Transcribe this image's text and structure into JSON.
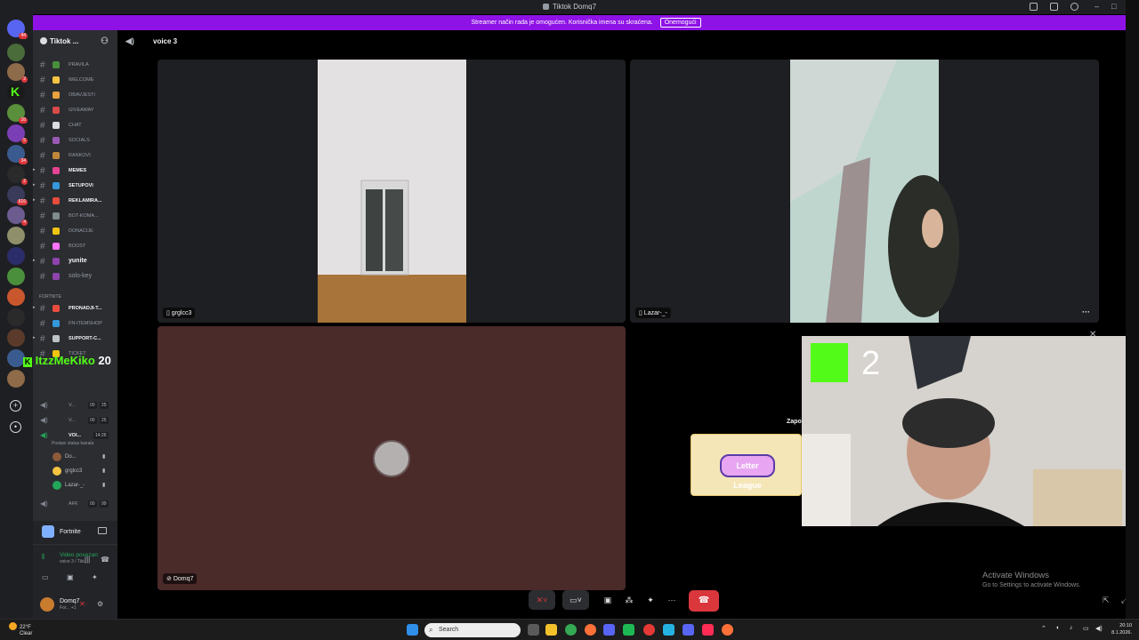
{
  "window": {
    "title": "Tiktok Domq7"
  },
  "banner": {
    "text": "Streamer način rada je omogućen. Korisnička imena su skraćena.",
    "button": "Onemogući"
  },
  "rail": {
    "home_badge": "44",
    "server_badges": [
      "2",
      "16",
      "5",
      "34",
      "2",
      "616",
      "4"
    ]
  },
  "server": {
    "name": "Tiktok ..."
  },
  "channels": [
    {
      "name": "PRAVILA",
      "emoji_color": "#4a8f3c"
    },
    {
      "name": "WELCOME",
      "emoji_color": "#f5c542"
    },
    {
      "name": "OBAVJESTI",
      "emoji_color": "#e8a23d"
    },
    {
      "name": "GIVEAWAY",
      "emoji_color": "#d94a4a"
    },
    {
      "name": "CHAT",
      "emoji_color": "#dbdee1"
    },
    {
      "name": "SOCIALS",
      "emoji_color": "#9b59b6"
    },
    {
      "name": "RANKOVI",
      "emoji_color": "#c0873a"
    },
    {
      "name": "MEMES",
      "emoji_color": "#e84393",
      "bold": true
    },
    {
      "name": "SETUPOVI",
      "emoji_color": "#3498db",
      "bold": true
    },
    {
      "name": "REKLAMIRA...",
      "emoji_color": "#e74c3c",
      "bold": true
    },
    {
      "name": "BOT-KOMA...",
      "emoji_color": "#7f8c8d"
    },
    {
      "name": "DONACIJE",
      "emoji_color": "#f1c40f"
    },
    {
      "name": "BOOST",
      "emoji_color": "#ff73fa"
    },
    {
      "name": "yunite",
      "emoji_color": "#8e44ad",
      "bold": true,
      "big": true
    },
    {
      "name": "solo-key",
      "emoji_color": "#8e44ad",
      "big": true
    }
  ],
  "category": {
    "name": "FORTNITE"
  },
  "fortnite_channels": [
    {
      "name": "PRONADJI-T...",
      "emoji_color": "#e74c3c",
      "bold": true
    },
    {
      "name": "FN-ITEMSHOP",
      "emoji_color": "#3498db"
    },
    {
      "name": "SUPPORT-C...",
      "emoji_color": "#bdc3c7",
      "bold": true
    },
    {
      "name": "TICKET",
      "emoji_color": "#f1c40f"
    }
  ],
  "overlay_name": "ItzzMeKiko",
  "overlay_count": "20",
  "voice_channels": [
    {
      "name": "V...",
      "a": "00",
      "b": "25"
    },
    {
      "name": "V...",
      "a": "00",
      "b": "25"
    },
    {
      "name": "VOI...",
      "time": "14:26",
      "active": true
    },
    {
      "name": "AFK",
      "a": "00",
      "b": "99"
    }
  ],
  "status_hint": "Postavi status kanala",
  "voice_users": [
    {
      "name": "Do...",
      "color": "#8e5a3a"
    },
    {
      "name": "grglcc3",
      "color": "#f5c542"
    },
    {
      "name": "Lazar-_-",
      "color": "#23a55a"
    }
  ],
  "activity": {
    "game": "Fortnite"
  },
  "connection": {
    "status": "Video povezan",
    "sub": "voice 3 / Tikt..."
  },
  "user": {
    "name": "Domq7",
    "status": "For... +1"
  },
  "voice_header": {
    "name": "voice 3"
  },
  "tiles": {
    "t1": "grglcc3",
    "t2": "Lazar-_-",
    "t3": "Domq7",
    "more": "···"
  },
  "letter_league": {
    "title": "Letter League",
    "label": "Zapo"
  },
  "kick": {
    "count": "2"
  },
  "watermark": {
    "line1": "Activate Windows",
    "line2": "Go to Settings to activate Windows."
  },
  "taskbar": {
    "temp": "22°F",
    "condition": "Clear",
    "search": "Search",
    "time": "20:10",
    "date": "8.1.2026."
  },
  "colors": {
    "accent": "#8e12e6",
    "hangup": "#da373c",
    "kick_green": "#53fc18"
  }
}
